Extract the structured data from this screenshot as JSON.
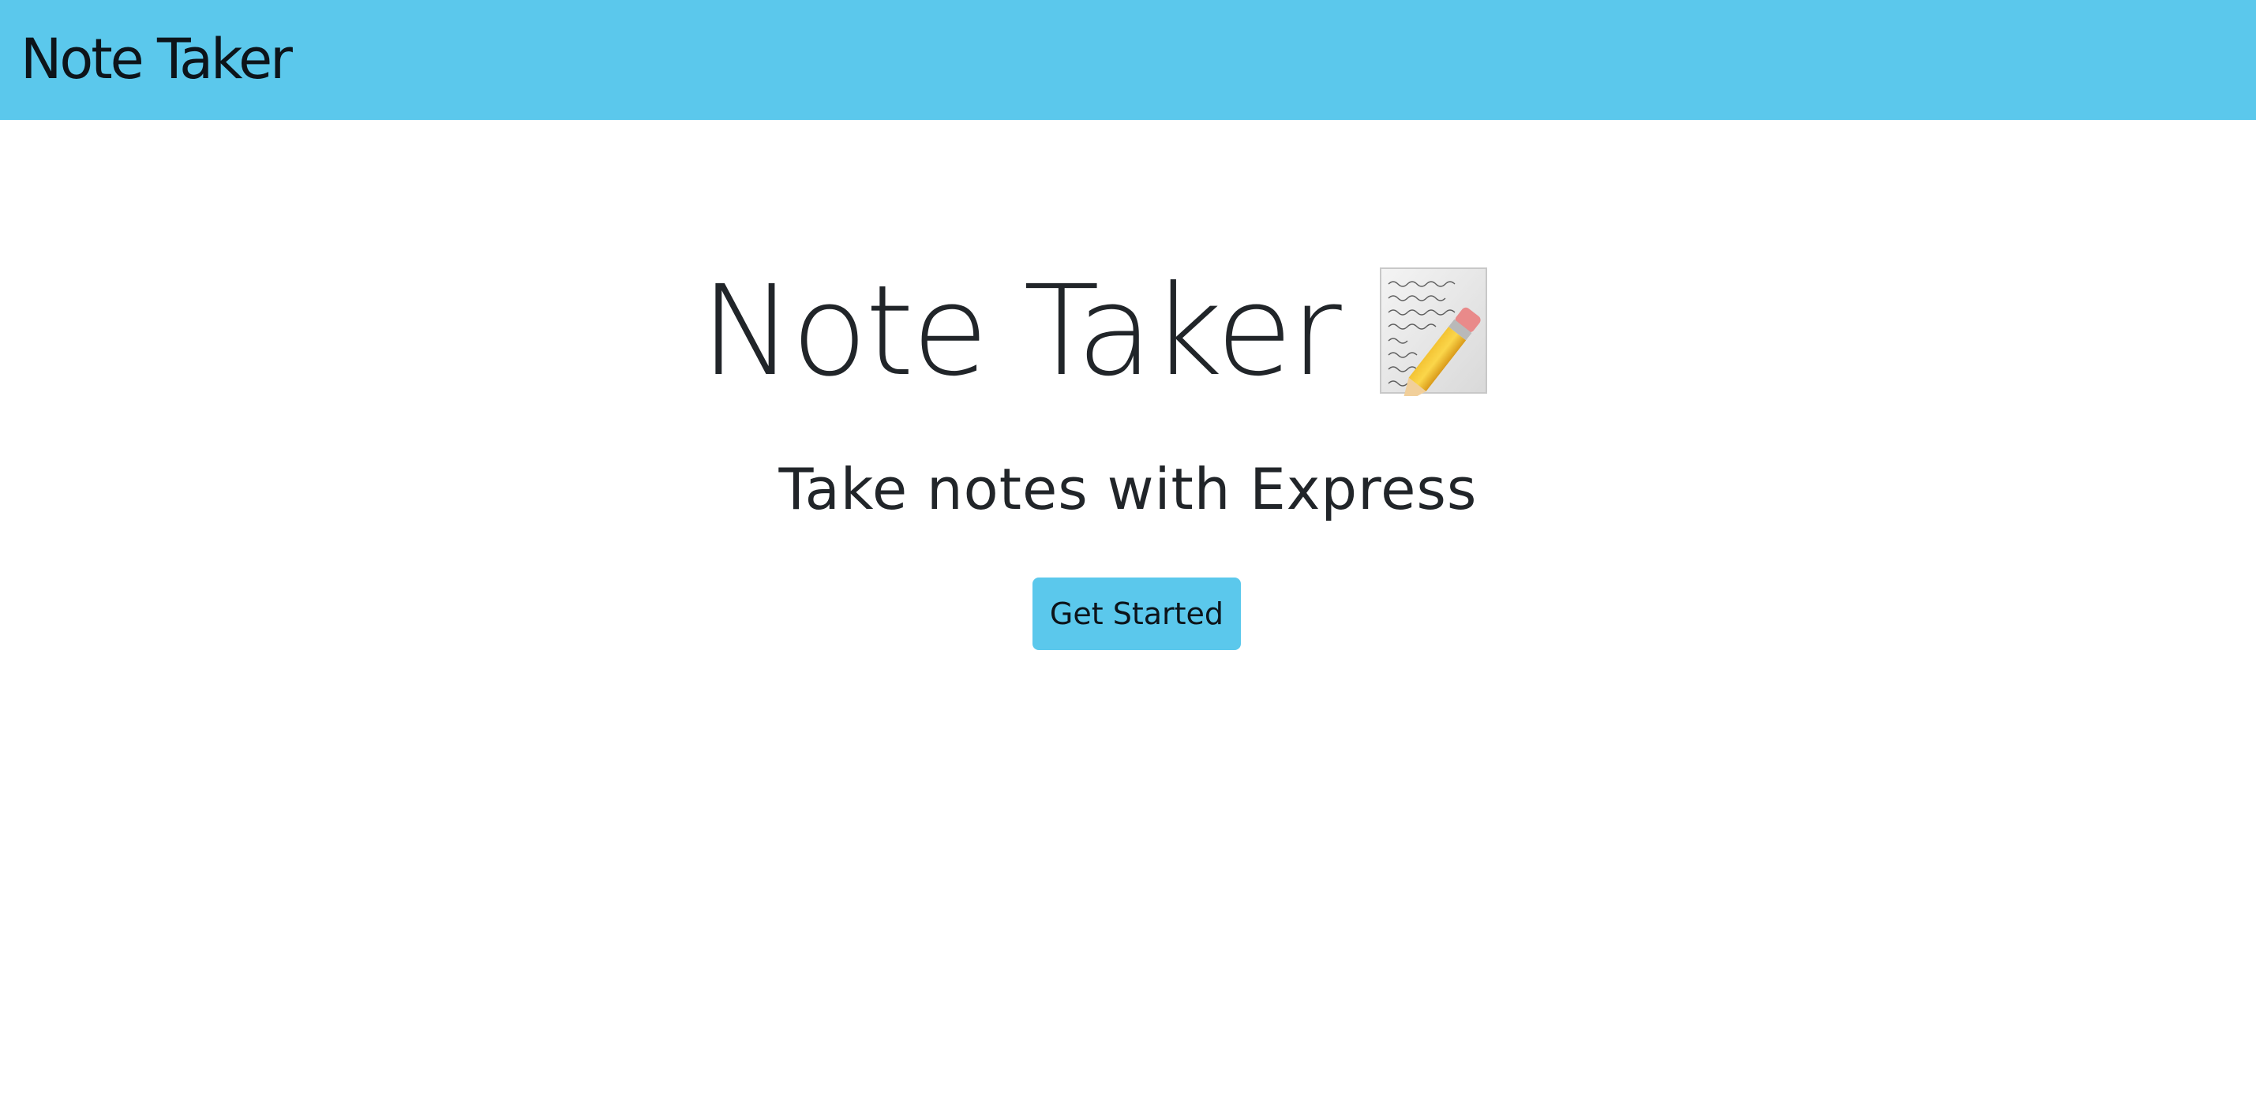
{
  "navbar": {
    "brand": "Note Taker",
    "background_color": "#5bc8ec"
  },
  "hero": {
    "title": "Note Taker",
    "title_icon": "memo-icon",
    "subtitle": "Take notes with Express",
    "button_label": "Get Started",
    "button_color": "#5bc8ec"
  }
}
